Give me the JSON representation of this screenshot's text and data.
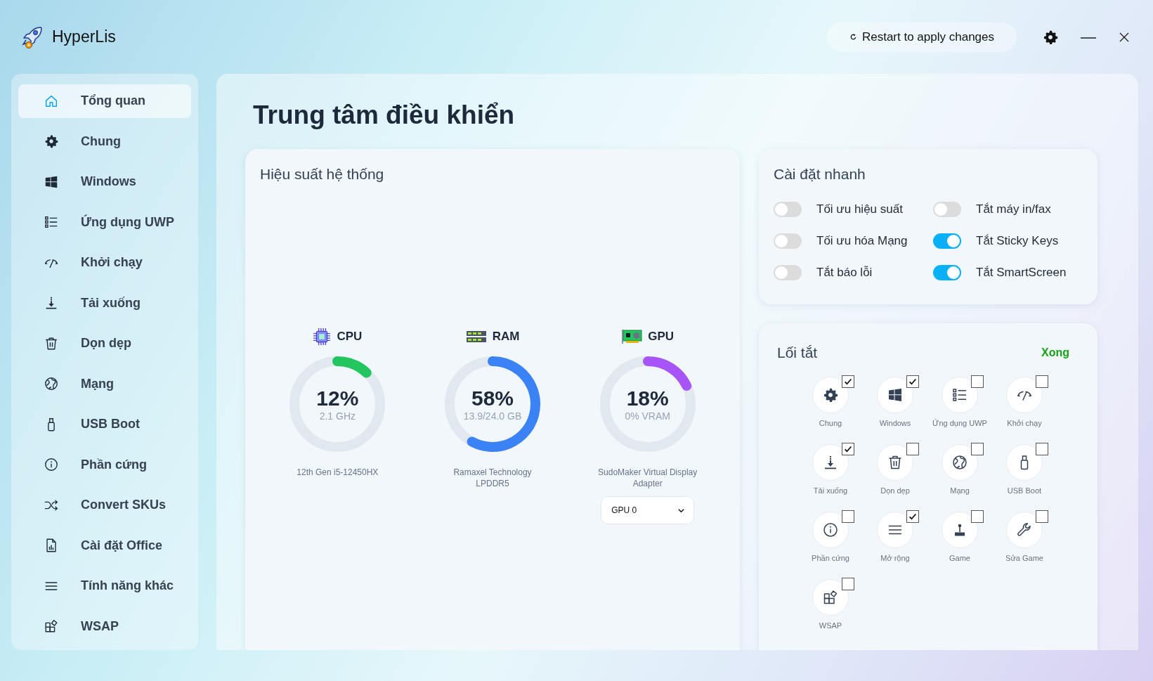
{
  "app": {
    "title": "HyperLis"
  },
  "header": {
    "restart_button": "Restart to apply changes"
  },
  "sidebar": {
    "items": [
      {
        "label": "Tổng quan",
        "selected": true
      },
      {
        "label": "Chung",
        "selected": false
      },
      {
        "label": "Windows",
        "selected": false
      },
      {
        "label": "Ứng dụng UWP",
        "selected": false
      },
      {
        "label": "Khởi chạy",
        "selected": false
      },
      {
        "label": "Tải xuống",
        "selected": false
      },
      {
        "label": "Dọn dẹp",
        "selected": false
      },
      {
        "label": "Mạng",
        "selected": false
      },
      {
        "label": "USB Boot",
        "selected": false
      },
      {
        "label": "Phần cứng",
        "selected": false
      },
      {
        "label": "Convert SKUs",
        "selected": false
      },
      {
        "label": "Cài đặt Office",
        "selected": false
      },
      {
        "label": "Tính năng khác",
        "selected": false
      },
      {
        "label": "WSAP",
        "selected": false
      }
    ]
  },
  "page": {
    "title": "Trung tâm điều khiển"
  },
  "performance": {
    "title": "Hiệu suất hệ thống",
    "gauges": [
      {
        "label": "CPU",
        "value": "12%",
        "detail": "2.1 GHz",
        "device": "12th Gen i5-12450HX",
        "color": "#22c55e"
      },
      {
        "label": "RAM",
        "value": "58%",
        "detail": "13.9/24.0 GB",
        "device": "Ramaxel Technology LPDDR5",
        "color": "#3b82f6"
      },
      {
        "label": "GPU",
        "value": "18%",
        "detail": "0% VRAM",
        "device": "SudoMaker Virtual Display Adapter",
        "color": "#a855f7",
        "select": "GPU 0"
      }
    ]
  },
  "quick_settings": {
    "title": "Cài đặt nhanh",
    "toggles": [
      {
        "label": "Tối ưu hiệu suất",
        "on": false
      },
      {
        "label": "Tắt máy in/fax",
        "on": false
      },
      {
        "label": "Tối ưu hóa Mạng",
        "on": false
      },
      {
        "label": "Tắt Sticky Keys",
        "on": true
      },
      {
        "label": "Tắt báo lỗi",
        "on": false
      },
      {
        "label": "Tắt SmartScreen",
        "on": true
      }
    ]
  },
  "shortcuts": {
    "title": "Lối tắt",
    "done_button": "Xong",
    "items": [
      {
        "label": "Chung",
        "checked": true
      },
      {
        "label": "Windows",
        "checked": true
      },
      {
        "label": "Ứng dụng UWP",
        "checked": false
      },
      {
        "label": "Khởi chạy",
        "checked": false
      },
      {
        "label": "Tải xuống",
        "checked": true
      },
      {
        "label": "Dọn dẹp",
        "checked": false
      },
      {
        "label": "Mạng",
        "checked": false
      },
      {
        "label": "USB Boot",
        "checked": false
      },
      {
        "label": "Phần cứng",
        "checked": false
      },
      {
        "label": "Mở rộng",
        "checked": true
      },
      {
        "label": "Game",
        "checked": false
      },
      {
        "label": "Sửa Game",
        "checked": false
      },
      {
        "label": "WSAP",
        "checked": false
      }
    ]
  }
}
